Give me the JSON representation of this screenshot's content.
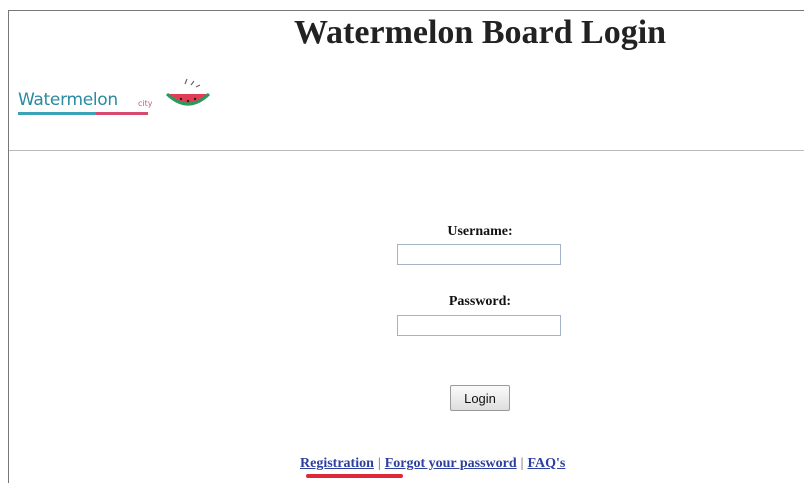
{
  "page": {
    "title": "Watermelon Board Login"
  },
  "logo": {
    "text": "Watermelon",
    "suffix": "city"
  },
  "form": {
    "username_label": "Username:",
    "username_value": "",
    "password_label": "Password:",
    "password_value": "",
    "login_label": "Login"
  },
  "links": {
    "registration": "Registration",
    "forgot_password": "Forgot your password",
    "faqs": "FAQ's",
    "separator": "|"
  },
  "colors": {
    "link": "#2c3fa0",
    "registration_highlight": "#e0283c",
    "logo_text": "#2a8aa0"
  },
  "icons": [
    "watermelon-slice-icon"
  ]
}
